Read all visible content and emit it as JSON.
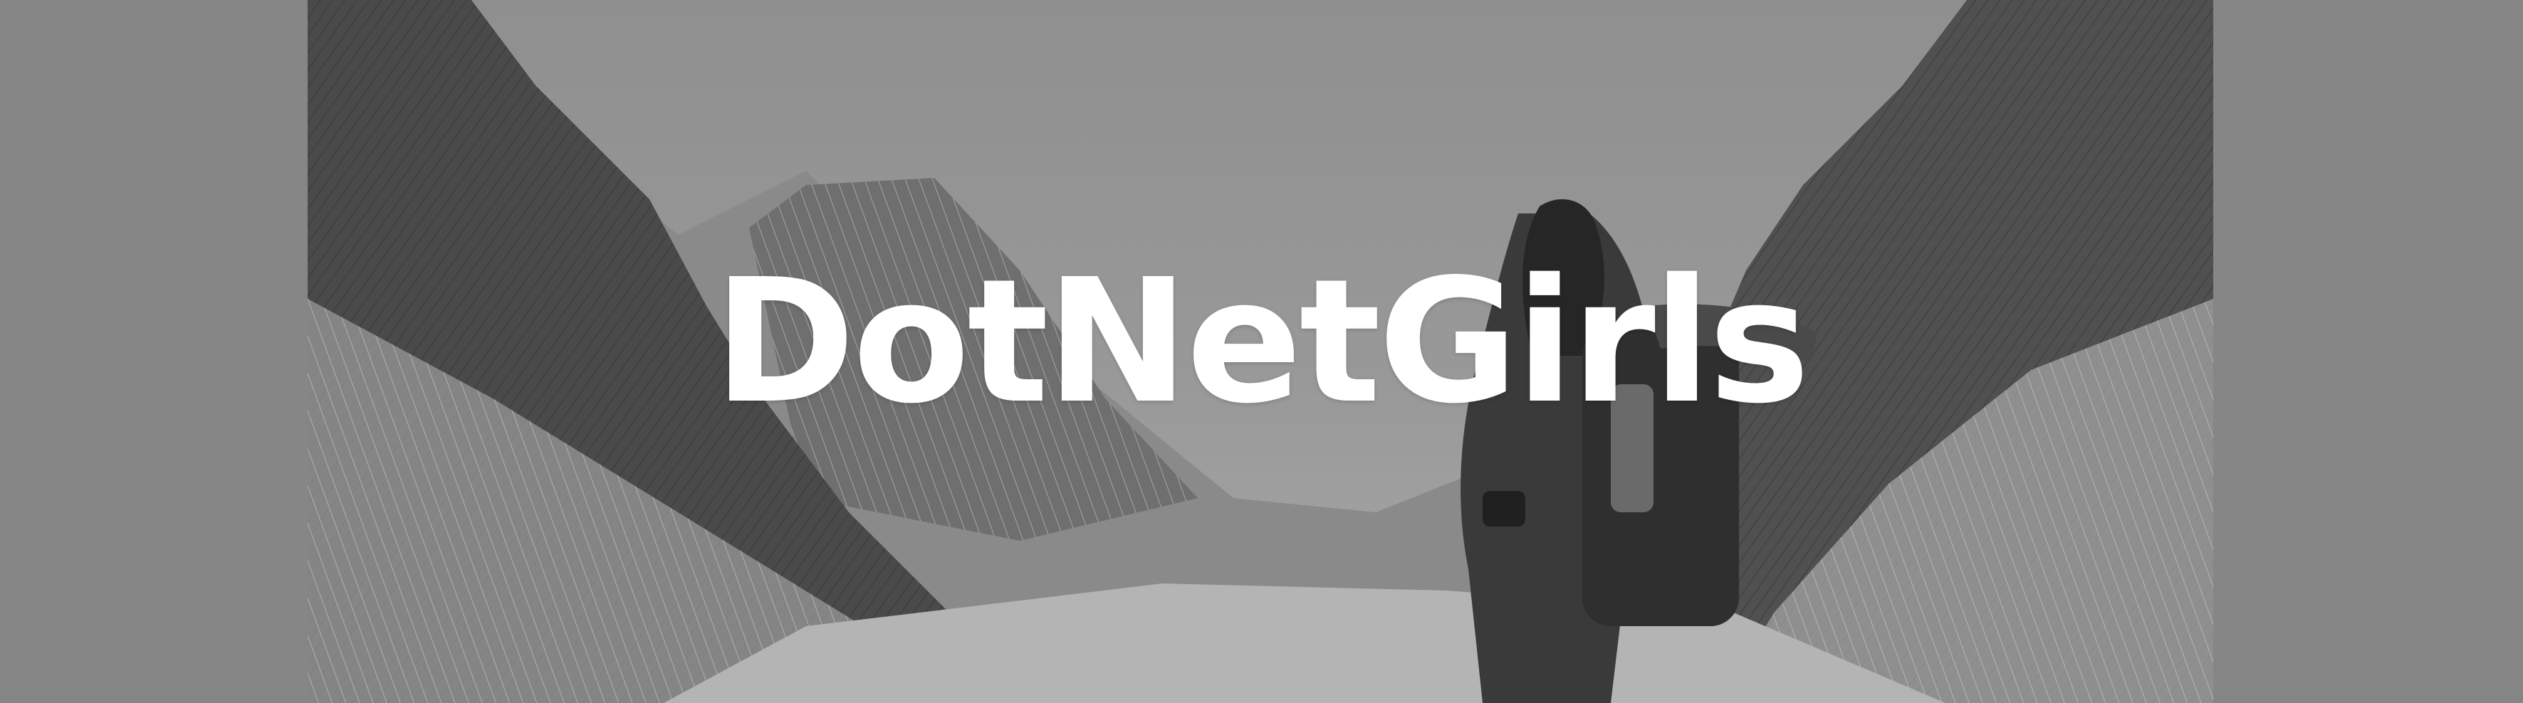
{
  "banner": {
    "title": "DotNetGirls"
  },
  "colors": {
    "page_background": "#868686",
    "title_text": "#ffffff",
    "sketch_dark": "#3c3c3c",
    "sky": "#959595"
  },
  "icons": {
    "illustration": "hiker-in-mountain-valley-sketch"
  }
}
